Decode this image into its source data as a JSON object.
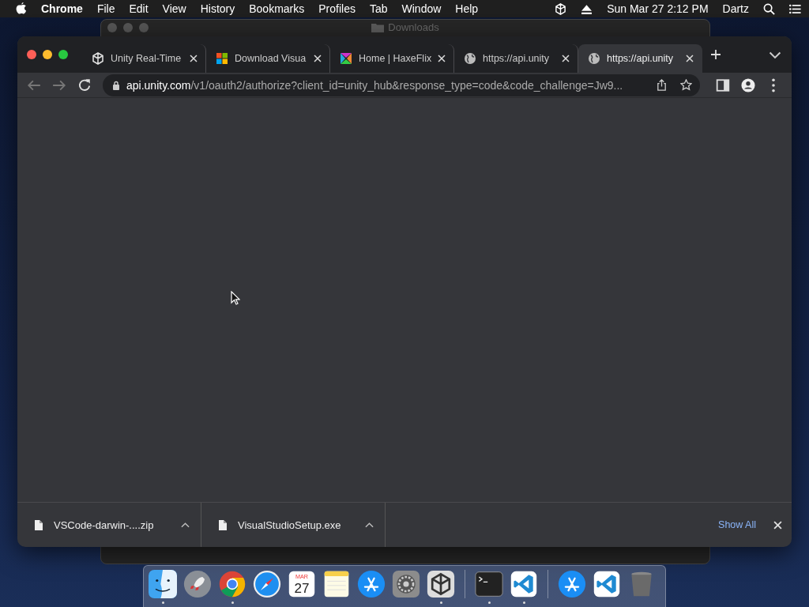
{
  "menu_bar": {
    "app": "Chrome",
    "items": [
      "File",
      "Edit",
      "View",
      "History",
      "Bookmarks",
      "Profiles",
      "Tab",
      "Window",
      "Help"
    ],
    "clock": "Sun Mar 27  2:12 PM",
    "user": "Dartz"
  },
  "finder_window": {
    "title": "Downloads"
  },
  "browser": {
    "tabs": [
      {
        "title": "Unity Real-Time",
        "kind": "unity",
        "selected": false
      },
      {
        "title": "Download Visua",
        "kind": "microsoft",
        "selected": false
      },
      {
        "title": "Home | HaxeFlix",
        "kind": "haxeflixel",
        "selected": false
      },
      {
        "title": "https://api.unity",
        "kind": "globe",
        "selected": false
      },
      {
        "title": "https://api.unity",
        "kind": "globe",
        "selected": true
      }
    ],
    "url_host": "api.unity.com",
    "url_path": "/v1/oauth2/authorize?client_id=unity_hub&response_type=code&code_challenge=Jw9...",
    "downloads": [
      {
        "name": "VSCode-darwin-....zip"
      },
      {
        "name": "VisualStudioSetup.exe"
      }
    ],
    "show_all": "Show All"
  },
  "dock": [
    {
      "kind": "finder",
      "running": true
    },
    {
      "kind": "launchpad",
      "running": false
    },
    {
      "kind": "chrome",
      "running": true
    },
    {
      "kind": "safari",
      "running": false
    },
    {
      "kind": "calendar",
      "month": "MAR",
      "day": "27",
      "running": false
    },
    {
      "kind": "notes",
      "running": false
    },
    {
      "kind": "appstore",
      "running": false
    },
    {
      "kind": "settings",
      "running": false
    },
    {
      "kind": "unity",
      "running": true
    },
    {
      "kind": "separator"
    },
    {
      "kind": "terminal",
      "running": true
    },
    {
      "kind": "vscode",
      "running": true
    },
    {
      "kind": "separator"
    },
    {
      "kind": "appstore-doc",
      "running": false
    },
    {
      "kind": "vscode-doc",
      "running": false
    },
    {
      "kind": "trash",
      "running": false
    }
  ]
}
